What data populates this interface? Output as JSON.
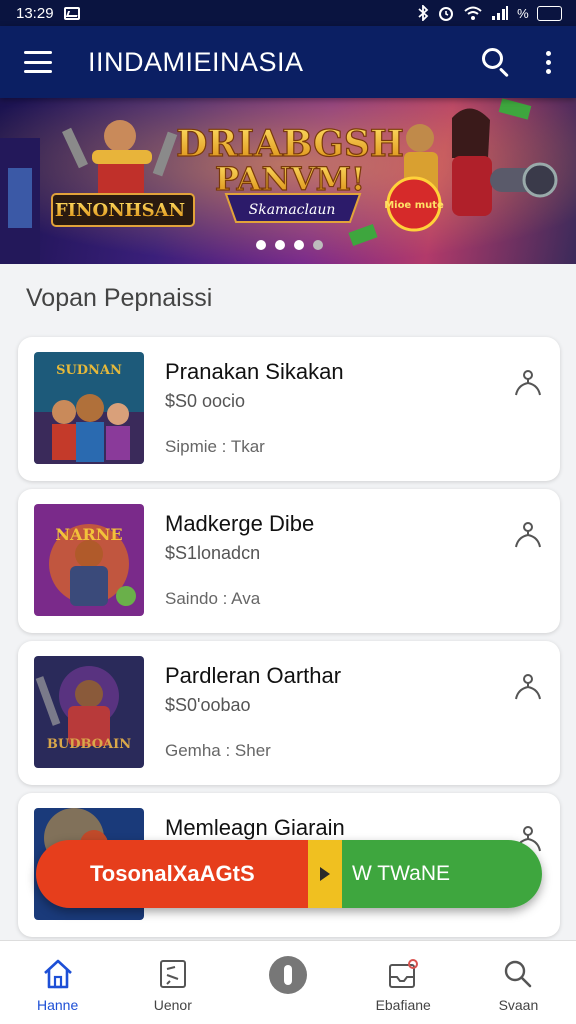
{
  "status_bar": {
    "time": "13:29",
    "battery": "%"
  },
  "app_bar": {
    "title": "IINDAMIEINASIA"
  },
  "banner": {
    "headline_line1": "DRIABGSH",
    "headline_line2": "PANVM!",
    "subtitle": "Skamaclaun",
    "left_logo": "FINONHSAN",
    "badge": "Mioe mute"
  },
  "section": {
    "title": "Vopan Pepnaissi"
  },
  "items": [
    {
      "title": "Pranakan Sikakan",
      "price": "$S0 oocio",
      "meta": "Sipmie : Tkar",
      "thumb_text": "SUDNAN",
      "colors": [
        "#1d5a7a",
        "#c43a2a",
        "#e6b93a"
      ]
    },
    {
      "title": "Madkerge Dibe",
      "price": "$S1lonadcn",
      "meta": "Saindo : Ava",
      "thumb_text": "NARNE",
      "colors": [
        "#7a2a8a",
        "#e06a20",
        "#f2c23a"
      ]
    },
    {
      "title": "Pardleran Oarthar",
      "price": "$S0'oobao",
      "meta": "Gemha : Sher",
      "thumb_text": "BUDBOAIN",
      "colors": [
        "#2a2a5a",
        "#b83a3a",
        "#d9a74a"
      ]
    },
    {
      "title": "Memleagn Giarain",
      "price": "",
      "meta": "",
      "thumb_text": "",
      "colors": [
        "#1a3a7a",
        "#c04a2a",
        "#e8a83a"
      ]
    }
  ],
  "cta": {
    "left_label": "TosonalXaAGtS",
    "right_label": "W TWaNE"
  },
  "bottom_nav": [
    {
      "label": "Hanne",
      "icon": "home-icon",
      "active": true
    },
    {
      "label": "Uenor",
      "icon": "document-icon",
      "active": false
    },
    {
      "label": "",
      "icon": "center-button-icon",
      "active": false
    },
    {
      "label": "Ebafiane",
      "icon": "inbox-icon",
      "active": false
    },
    {
      "label": "Svaan",
      "icon": "search-icon",
      "active": false
    }
  ]
}
